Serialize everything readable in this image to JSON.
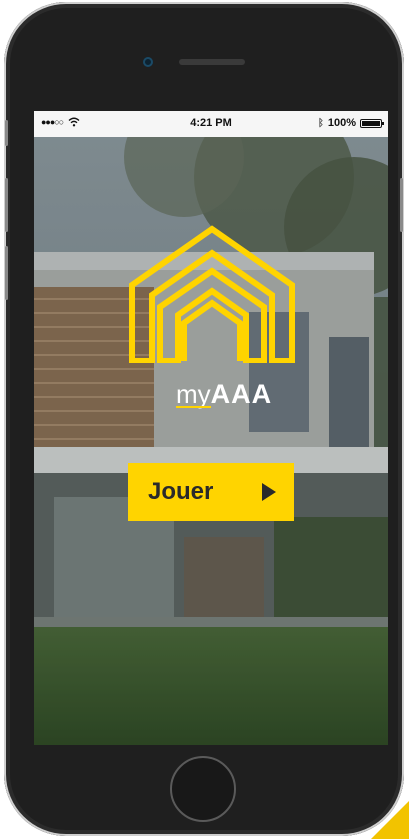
{
  "statusbar": {
    "signal": "●●●○○",
    "time": "4:21 PM",
    "battery": "100%"
  },
  "brand": {
    "prefix": "my",
    "name": "AAA"
  },
  "play_button": {
    "label": "Jouer"
  },
  "colors": {
    "accent": "#ffd400",
    "phone_body": "#1f1f1f"
  },
  "icons": [
    "wifi-icon",
    "bluetooth-icon",
    "battery-icon",
    "house-logo-icon",
    "play-icon"
  ]
}
